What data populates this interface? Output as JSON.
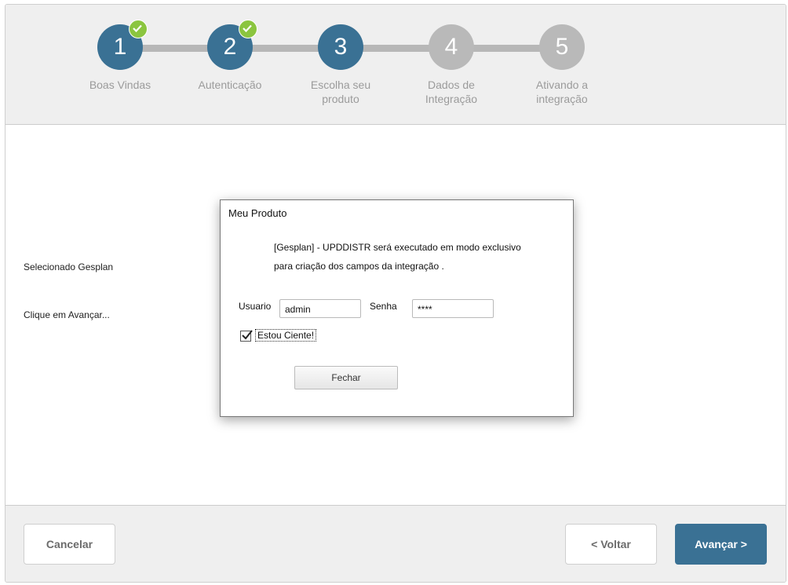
{
  "steps": [
    {
      "number": "1",
      "label": "Boas Vindas",
      "state": "done"
    },
    {
      "number": "2",
      "label": "Autenticação",
      "state": "done"
    },
    {
      "number": "3",
      "label": "Escolha seu produto",
      "state": "current"
    },
    {
      "number": "4",
      "label": "Dados de Integração",
      "state": "pending"
    },
    {
      "number": "5",
      "label": "Ativando a integração",
      "state": "pending"
    }
  ],
  "content": {
    "selected_text": "Selecionado Gesplan",
    "instruction_text": "Clique em Avançar..."
  },
  "modal": {
    "title": "Meu Produto",
    "message_line1": "[Gesplan] - UPDDISTR será executado em modo exclusivo",
    "message_line2": "para criação dos campos da integração .",
    "user_label": "Usuario",
    "user_value": "admin",
    "password_label": "Senha",
    "password_value": "****",
    "checkbox_label": "Estou Ciente!",
    "checkbox_checked": true,
    "close_label": "Fechar"
  },
  "footer": {
    "cancel_label": "Cancelar",
    "back_label": "< Voltar",
    "next_label": "Avançar >"
  },
  "colors": {
    "accent": "#3a7194",
    "done_check": "#8bc53f",
    "inactive_step": "#b9b9b9"
  },
  "icons": {
    "step_done": "check-icon",
    "checkbox": "checkmark-icon"
  }
}
